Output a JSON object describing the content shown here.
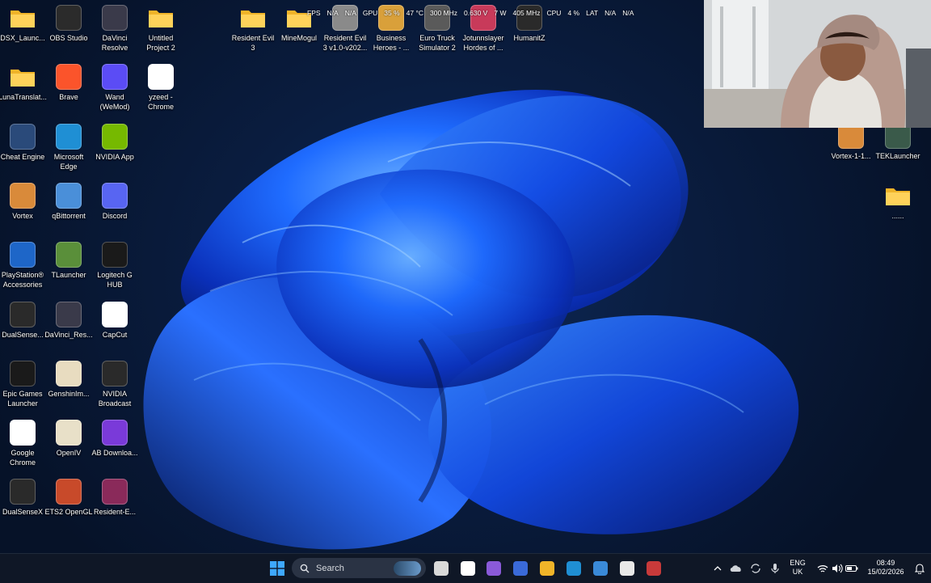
{
  "desktop": {
    "left_icons": [
      {
        "label": "DSX_Launc...",
        "icon": "folder-icon",
        "kind": "folder"
      },
      {
        "label": "OBS Studio",
        "icon": "obs-icon",
        "color": "#2b2b2b"
      },
      {
        "label": "DaVinci Resolve",
        "icon": "davinci-icon",
        "color": "#3a3a4a"
      },
      {
        "label": "Untitled Project 2",
        "icon": "folder-icon",
        "kind": "folder"
      },
      {
        "label": "LunaTranslat...",
        "icon": "folder-icon",
        "kind": "folder"
      },
      {
        "label": "Brave",
        "icon": "brave-icon",
        "color": "#fb542b"
      },
      {
        "label": "Wand (WeMod)",
        "icon": "wand-icon",
        "color": "#5b4cf5"
      },
      {
        "label": "yzeed - Chrome",
        "icon": "chrome-icon",
        "color": "#ffffff"
      },
      {
        "label": "Cheat Engine",
        "icon": "cheat-engine-icon",
        "color": "#2a4a7a"
      },
      {
        "label": "Microsoft Edge",
        "icon": "edge-icon",
        "color": "#1f8fd4"
      },
      {
        "label": "NVIDIA App",
        "icon": "nvidia-icon",
        "color": "#76b900"
      },
      {
        "label": "Vortex",
        "icon": "vortex-icon",
        "color": "#d98a3a"
      },
      {
        "label": "qBittorrent",
        "icon": "qbittorrent-icon",
        "color": "#4a8fd9"
      },
      {
        "label": "Discord",
        "icon": "discord-icon",
        "color": "#5865f2"
      },
      {
        "label": "PlayStation® Accessories",
        "icon": "playstation-icon",
        "color": "#1e66c8"
      },
      {
        "label": "TLauncher",
        "icon": "tlauncher-icon",
        "color": "#5a8f3a"
      },
      {
        "label": "Logitech G HUB",
        "icon": "logitech-icon",
        "color": "#1a1a1a"
      },
      {
        "label": "DualSense...",
        "icon": "controller-icon",
        "color": "#2a2a2a"
      },
      {
        "label": "DaVinci_Res...",
        "icon": "davinci-icon",
        "color": "#3a3a4a"
      },
      {
        "label": "CapCut",
        "icon": "capcut-icon",
        "color": "#ffffff"
      },
      {
        "label": "Epic Games Launcher",
        "icon": "epic-icon",
        "color": "#1a1a1a"
      },
      {
        "label": "GenshinIm...",
        "icon": "genshin-icon",
        "color": "#e8dcc0"
      },
      {
        "label": "NVIDIA Broadcast",
        "icon": "nvidia-broadcast-icon",
        "color": "#2a2a2a"
      },
      {
        "label": "Google Chrome",
        "icon": "chrome-icon",
        "color": "#ffffff"
      },
      {
        "label": "OpenIV",
        "icon": "openiv-icon",
        "color": "#e8e0c8"
      },
      {
        "label": "AB Downloa...",
        "icon": "ab-download-icon",
        "color": "#7a3ad9"
      },
      {
        "label": "DualSenseX",
        "icon": "controller-icon",
        "color": "#2a2a2a"
      },
      {
        "label": "ETS2 OpenGL",
        "icon": "ets2-icon",
        "color": "#c84a2a"
      },
      {
        "label": "Resident-E...",
        "icon": "winrar-icon",
        "color": "#8a2a5a"
      }
    ],
    "top_icons": [
      {
        "label": "Resident Evil 3",
        "icon": "folder-icon",
        "kind": "folder"
      },
      {
        "label": "MineMogul",
        "icon": "folder-icon",
        "kind": "folder"
      },
      {
        "label": "Resident Evil 3 v1.0-v202...",
        "icon": "game-icon",
        "color": "#8a8a8a"
      },
      {
        "label": "Business Heroes - ...",
        "icon": "game-icon",
        "color": "#d9a03a"
      },
      {
        "label": "Euro Truck Simulator 2",
        "icon": "ets2-icon",
        "color": "#5a5a5a"
      },
      {
        "label": "Jotunnslayer Hordes of ...",
        "icon": "game-icon",
        "color": "#c83a5a"
      },
      {
        "label": "HumanitZ",
        "icon": "game-icon",
        "color": "#2a2a2a"
      }
    ],
    "right_icons": [
      {
        "label": "Vortex-1-1...",
        "icon": "vortex-icon",
        "color": "#d98a3a"
      },
      {
        "label": "TEKLauncher",
        "icon": "tek-icon",
        "color": "#3a5a4a"
      },
      {
        "label": "......",
        "icon": "folder-icon",
        "kind": "folder"
      }
    ]
  },
  "overlay": {
    "fps_label": "FPS",
    "fps_value": "N/A",
    "fps_value2": "N/A",
    "gpu_label": "GPU",
    "gpu_usage": "35 %",
    "gpu_temp": "47 °C",
    "gpu_clock": "300 MHz",
    "gpu_voltage": "0.630 V",
    "gpu_power": "7 W",
    "gpu_mem": "405 MHz",
    "cpu_label": "CPU",
    "cpu_usage": "4 %",
    "lat_label": "LAT",
    "lat_value": "N/A",
    "lat_value2": "N/A"
  },
  "taskbar": {
    "search_label": "Search",
    "lang_top": "ENG",
    "lang_bottom": "UK",
    "time": "08:49",
    "date": "15/02/2026",
    "apps": [
      {
        "icon": "file-explorer-dark-icon",
        "color": "#d9d9d9"
      },
      {
        "icon": "chrome-icon",
        "color": "#ffffff"
      },
      {
        "icon": "app-icon",
        "color": "#8a5ad9"
      },
      {
        "icon": "app-icon",
        "color": "#3a6ad9"
      },
      {
        "icon": "file-explorer-icon",
        "color": "#f0b429"
      },
      {
        "icon": "edge-icon",
        "color": "#1f8fd4"
      },
      {
        "icon": "app-icon",
        "color": "#3a8ad9"
      },
      {
        "icon": "store-icon",
        "color": "#e8e8e8"
      },
      {
        "icon": "app-icon",
        "color": "#c83a3a"
      }
    ]
  },
  "colors": {
    "accent": "#1a5fff",
    "taskbar_bg": "#0f1726"
  }
}
